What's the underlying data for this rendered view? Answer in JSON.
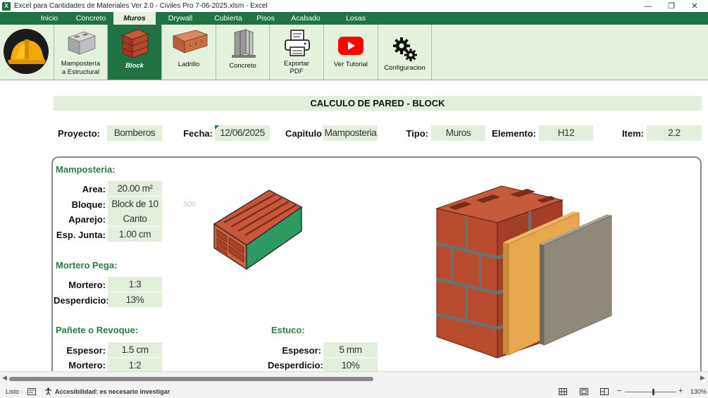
{
  "window": {
    "title": "Excel para Cantidades de Materiales Ver 2.0 - Civiles Pro 7-06-2025.xlsm  -  Excel",
    "app_icon": "X",
    "minimize": "—",
    "restore": "❐",
    "close": "✕"
  },
  "tabs": [
    "Inicio",
    "Concreto",
    "Muros",
    "Drywall",
    "Cubierta",
    "Pisos",
    "Acabado",
    "Losas"
  ],
  "ribbon": {
    "mamposteria_line1": "Mampostería",
    "mamposteria_line2": "a Estructural",
    "block": "Block",
    "ladrillo": "Ladrillo",
    "concreto": "Concreto",
    "exportar_line1": "Exportar",
    "exportar_line2": "PDF",
    "tutorial": "Ver Tutorial",
    "config": "Configuracion"
  },
  "sheet": {
    "banner": "CALCULO DE PARED - BLOCK",
    "header": {
      "proyecto_label": "Proyecto:",
      "proyecto": "Bomberos",
      "fecha_label": "Fecha:",
      "fecha": "12/06/2025",
      "capitulo_label": "Capitulo",
      "capitulo": "Mamposteria",
      "tipo_label": "Tipo:",
      "tipo": "Muros",
      "elemento_label": "Elemento:",
      "elemento": "H12",
      "item_label": "Item:",
      "item": "2.2"
    },
    "mamposteria": {
      "title": "Mamposteria:",
      "area_label": "Area:",
      "area": "20.00 m²",
      "bloque_label": "Bloque:",
      "bloque": "Block de 10",
      "aparejo_label": "Aparejo:",
      "aparejo": "Canto",
      "junta_label": "Esp. Junta:",
      "junta": "1.00 cm",
      "faint_number": ".500"
    },
    "mortero": {
      "title": "Mortero Pega:",
      "mortero_label": "Mortero:",
      "mortero": "1:3",
      "desperdicio_label": "Desperdicio:",
      "desperdicio": "13%"
    },
    "panete": {
      "title": "Pañete o Revoque:",
      "espesor_label": "Espesor:",
      "espesor": "1.5 cm",
      "mortero_label": "Mortero:",
      "mortero": "1:2"
    },
    "estuco": {
      "title": "Estuco:",
      "espesor_label": "Espesor:",
      "espesor": "5 mm",
      "desperdicio_label": "Desperdicio:",
      "desperdicio": "10%"
    }
  },
  "statusbar": {
    "ready": "Listo",
    "accessibility": "Accesibilidad: es necesario investigar",
    "zoom": "130%",
    "minus": "−",
    "plus": "+"
  }
}
